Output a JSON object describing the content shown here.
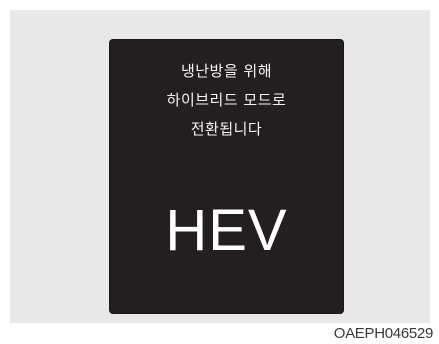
{
  "display": {
    "message_lines": [
      "냉난방을 위해",
      "하이브리드 모드로",
      "전환됩니다"
    ],
    "mode_label": "HEV"
  },
  "figure_code": "OAEPH046529",
  "colors": {
    "panel_background": "#e8e8e8",
    "screen_background": "#231f20",
    "screen_text": "#ffffff"
  }
}
